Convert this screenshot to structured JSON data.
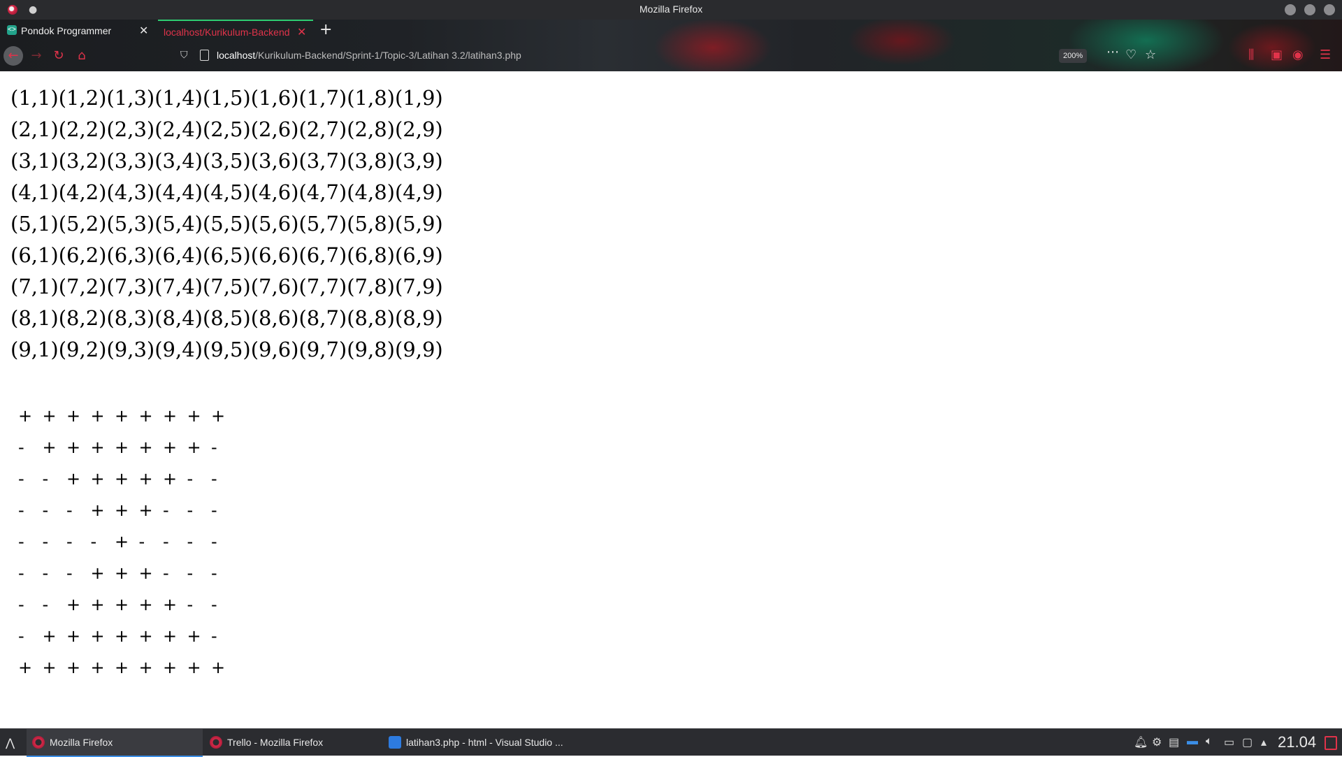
{
  "window": {
    "title": "Mozilla Firefox"
  },
  "tabs": [
    {
      "label": "Pondok Programmer",
      "favicon": "code-brackets-icon",
      "active": false
    },
    {
      "label": "localhost/Kurikulum-Backend",
      "active": true
    }
  ],
  "toolbar": {
    "url_host": "localhost",
    "url_path": "/Kurikulum-Backend/Sprint-1/Topic-3/Latihan 3.2/latihan3.php",
    "zoom": "200%"
  },
  "coords": [
    "(1,1)(1,2)(1,3)(1,4)(1,5)(1,6)(1,7)(1,8)(1,9)",
    "(2,1)(2,2)(2,3)(2,4)(2,5)(2,6)(2,7)(2,8)(2,9)",
    "(3,1)(3,2)(3,3)(3,4)(3,5)(3,6)(3,7)(3,8)(3,9)",
    "(4,1)(4,2)(4,3)(4,4)(4,5)(4,6)(4,7)(4,8)(4,9)",
    "(5,1)(5,2)(5,3)(5,4)(5,5)(5,6)(5,7)(5,8)(5,9)",
    "(6,1)(6,2)(6,3)(6,4)(6,5)(6,6)(6,7)(6,8)(6,9)",
    "(7,1)(7,2)(7,3)(7,4)(7,5)(7,6)(7,7)(7,8)(7,9)",
    "(8,1)(8,2)(8,3)(8,4)(8,5)(8,6)(8,7)(8,8)(8,9)",
    "(9,1)(9,2)(9,3)(9,4)(9,5)(9,6)(9,7)(9,8)(9,9)"
  ],
  "pattern": [
    [
      "+",
      "+",
      "+",
      "+",
      "+",
      "+",
      "+",
      "+",
      "+"
    ],
    [
      "-",
      "+",
      "+",
      "+",
      "+",
      "+",
      "+",
      "+",
      "-"
    ],
    [
      "-",
      "-",
      "+",
      "+",
      "+",
      "+",
      "+",
      "-",
      "-"
    ],
    [
      "-",
      "-",
      "-",
      "+",
      "+",
      "+",
      "-",
      "-",
      "-"
    ],
    [
      "-",
      "-",
      "-",
      "-",
      "+",
      "-",
      "-",
      "-",
      "-"
    ],
    [
      "-",
      "-",
      "-",
      "+",
      "+",
      "+",
      "-",
      "-",
      "-"
    ],
    [
      "-",
      "-",
      "+",
      "+",
      "+",
      "+",
      "+",
      "-",
      "-"
    ],
    [
      "-",
      "+",
      "+",
      "+",
      "+",
      "+",
      "+",
      "+",
      "-"
    ],
    [
      "+",
      "+",
      "+",
      "+",
      "+",
      "+",
      "+",
      "+",
      "+"
    ]
  ],
  "taskbar": {
    "items": [
      {
        "label": "Mozilla Firefox",
        "icon": "firefox-icon",
        "active": true
      },
      {
        "label": "Trello - Mozilla Firefox",
        "icon": "firefox-icon",
        "active": false
      },
      {
        "label": "latihan3.php - html - Visual Studio ...",
        "icon": "vscode-icon",
        "active": false
      }
    ],
    "clock": "21.04"
  },
  "colors": {
    "accent": "#e0334a",
    "active_tab_line": "#2ecc71",
    "taskbar_active": "#3b8ee6"
  }
}
